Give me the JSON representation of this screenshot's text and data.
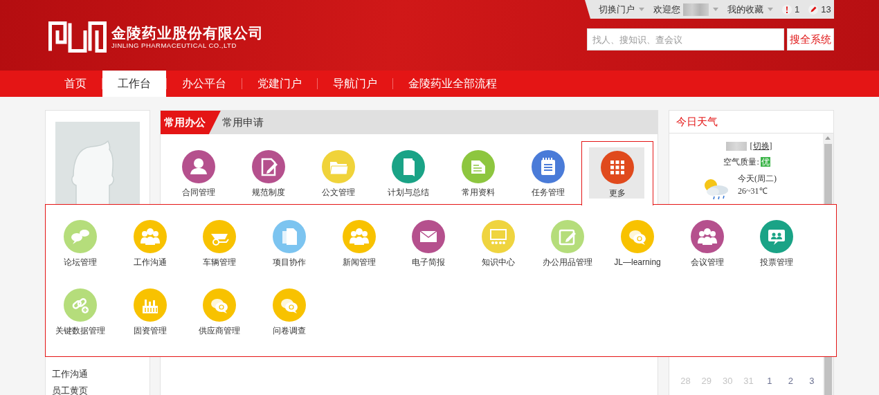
{
  "header": {
    "logo": {
      "name": "金陵药业股份有限公司",
      "english": "JINLING PHARMACEUTICAL CO.,LTD"
    },
    "top_links": [
      {
        "kind": "link",
        "label": "切换门户"
      },
      {
        "kind": "user",
        "label": "欢迎您"
      },
      {
        "kind": "link",
        "label": "我的收藏"
      }
    ],
    "notifications": [
      {
        "kind": "alert",
        "count": "1"
      },
      {
        "kind": "edit",
        "count": "13"
      }
    ],
    "search": {
      "placeholder": "找人、搜知识、查会议",
      "button": "搜全系统"
    }
  },
  "nav": [
    {
      "label": "首页",
      "selected": false
    },
    {
      "label": "工作台",
      "selected": true
    },
    {
      "label": "办公平台",
      "selected": false
    },
    {
      "label": "党建门户",
      "selected": false
    },
    {
      "label": "导航门户",
      "selected": false
    },
    {
      "label": "金陵药业全部流程",
      "selected": false
    }
  ],
  "sidebar": {
    "items": [
      "工作沟通",
      "员工黄页"
    ]
  },
  "office": {
    "tabs": [
      {
        "label": "常用办公",
        "selected": true
      },
      {
        "label": "常用申请",
        "selected": false
      }
    ],
    "apps": [
      {
        "label": "合同管理",
        "kind": "person",
        "color": "#b5508d",
        "selected": false
      },
      {
        "label": "规范制度",
        "kind": "doc-edit",
        "color": "#b5508d",
        "selected": false
      },
      {
        "label": "公文管理",
        "kind": "folder",
        "color": "#f0d33a",
        "selected": false
      },
      {
        "label": "计划与总结",
        "kind": "book",
        "color": "#1aa386",
        "selected": false
      },
      {
        "label": "常用资料",
        "kind": "doc",
        "color": "#8dc63f",
        "selected": false
      },
      {
        "label": "任务管理",
        "kind": "notepad",
        "color": "#4a7bd8",
        "selected": false
      },
      {
        "label": "更多",
        "kind": "grid",
        "color": "#e04a1d",
        "selected": true
      }
    ]
  },
  "more_menu": {
    "apps": [
      {
        "label": "论坛管理",
        "kind": "bubbles",
        "color": "#b5dd7b"
      },
      {
        "label": "工作沟通",
        "kind": "people",
        "color": "#f8c200"
      },
      {
        "label": "车辆管理",
        "kind": "cart",
        "color": "#f8c200"
      },
      {
        "label": "项目协作",
        "kind": "docs",
        "color": "#7cc4f0"
      },
      {
        "label": "新闻管理",
        "kind": "people",
        "color": "#f8c200"
      },
      {
        "label": "电子简报",
        "kind": "envelope",
        "color": "#b5508d"
      },
      {
        "label": "知识中心",
        "kind": "screen",
        "color": "#efd43f"
      },
      {
        "label": "办公用品管理",
        "kind": "edit",
        "color": "#b5dd7b"
      },
      {
        "label": "JL—learning",
        "kind": "question",
        "color": "#f8c200"
      },
      {
        "label": "会议管理",
        "kind": "people",
        "color": "#b5508d"
      },
      {
        "label": "投票管理",
        "kind": "chat",
        "color": "#1aa386"
      },
      {
        "label": "关键数据管理",
        "kind": "link",
        "color": "#b5dd7b"
      },
      {
        "label": "固资管理",
        "kind": "factory",
        "color": "#f8c200"
      },
      {
        "label": "供应商管理",
        "kind": "question",
        "color": "#f8c200"
      },
      {
        "label": "问卷调查",
        "kind": "question",
        "color": "#f8c200"
      }
    ]
  },
  "weather": {
    "title": "今日天气",
    "switch": "[切换]",
    "air_label": "空气质量:",
    "air_value": "优",
    "day": "今天(周二)",
    "temperature": "26~31℃"
  },
  "calendar": {
    "days": [
      {
        "label": "28",
        "other_month": true
      },
      {
        "label": "29",
        "other_month": true
      },
      {
        "label": "30",
        "other_month": true
      },
      {
        "label": "31",
        "other_month": true
      },
      {
        "label": "1",
        "other_month": false
      },
      {
        "label": "2",
        "other_month": false
      },
      {
        "label": "3",
        "other_month": false
      }
    ]
  }
}
